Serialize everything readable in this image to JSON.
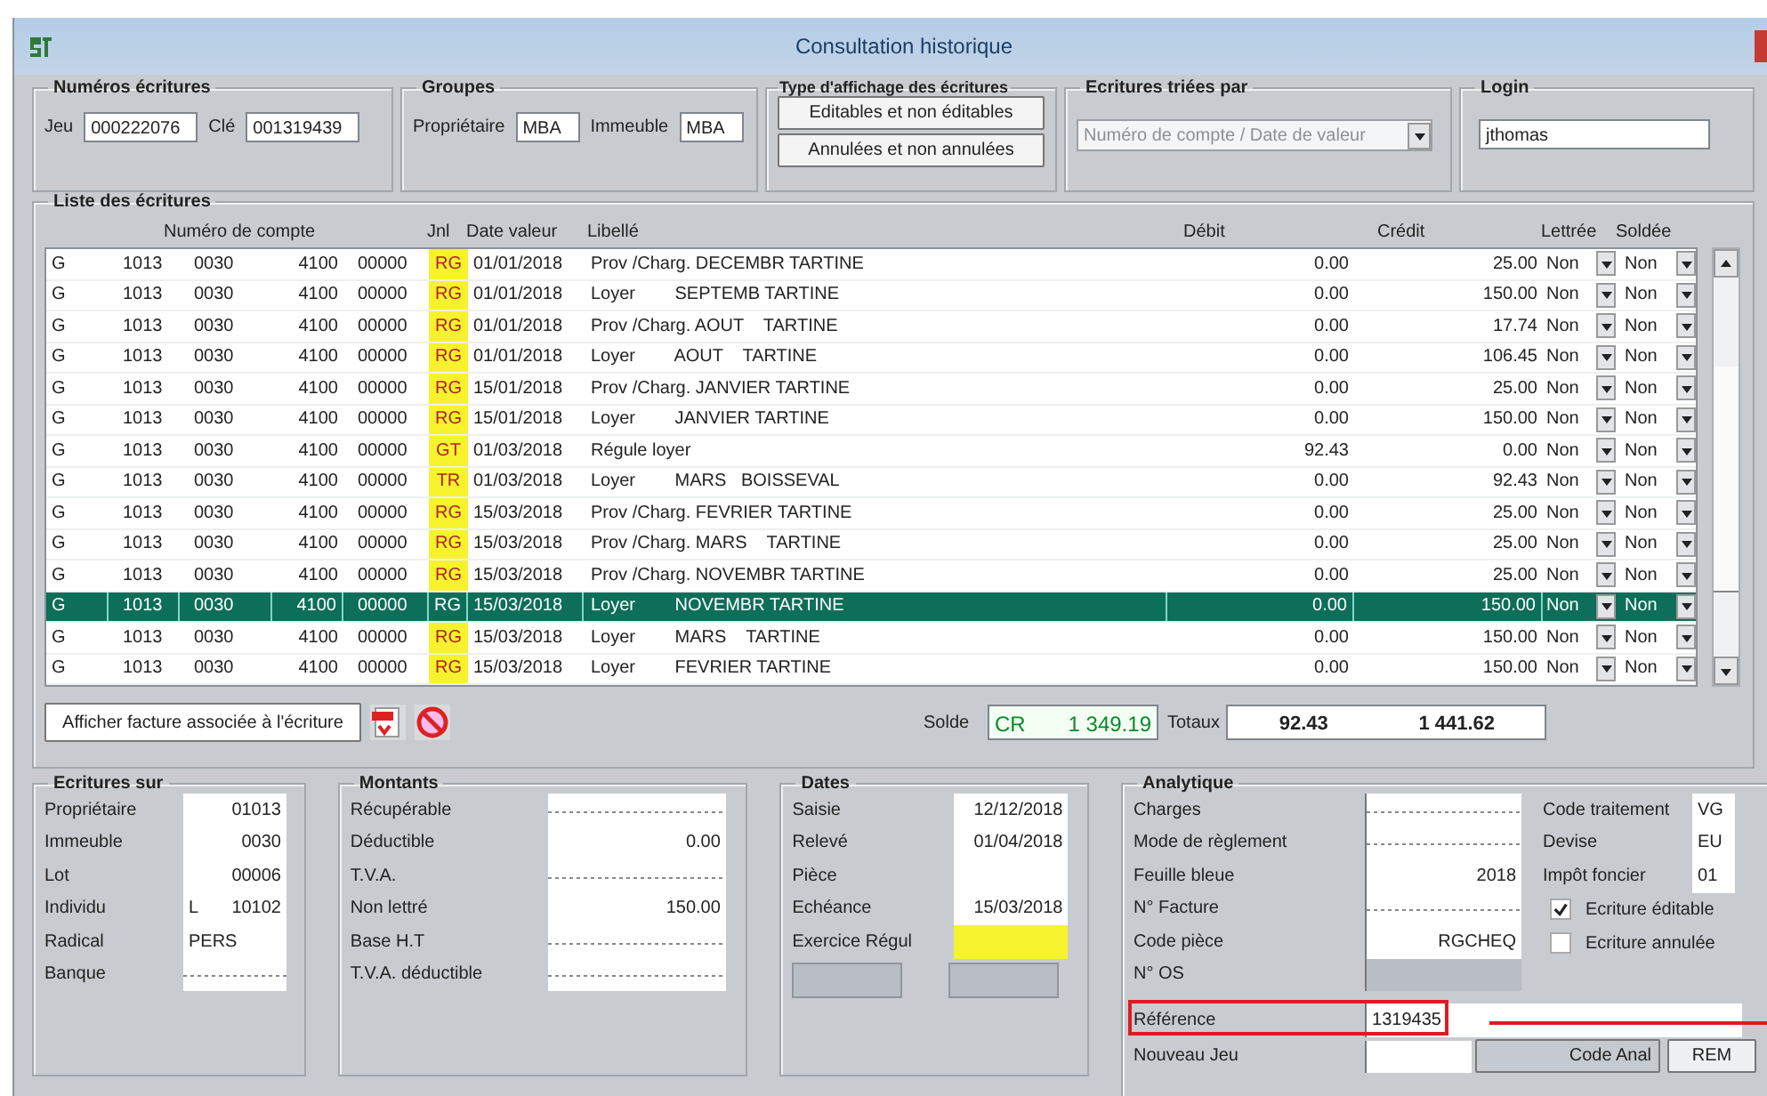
{
  "window": {
    "title": "Consultation historique"
  },
  "numeros": {
    "title": "Numéros écritures",
    "fields": [
      {
        "label": "Jeu",
        "value": "000222076"
      },
      {
        "label": "Clé",
        "value": "001319439"
      }
    ]
  },
  "groupes": {
    "title": "Groupes",
    "fields": [
      {
        "label": "Propriétaire",
        "value": "MBA"
      },
      {
        "label": "Immeuble",
        "value": "MBA"
      }
    ]
  },
  "affichage": {
    "title": "Type d'affichage des écritures",
    "buttons": [
      "Editables et non éditables",
      "Annulées et non annulées"
    ]
  },
  "tri": {
    "title": "Ecritures triées par",
    "value": "Numéro de compte / Date de valeur",
    "disabled": true
  },
  "login": {
    "title": "Login",
    "value": "jthomas"
  },
  "list": {
    "title": "Liste des écritures",
    "columns": [
      "Numéro de compte",
      "Jnl",
      "Date valeur",
      "Libellé",
      "Débit",
      "Crédit",
      "Lettrée",
      "Soldée"
    ],
    "rows": [
      {
        "type": "G",
        "account": [
          "1013",
          "0030",
          "4100",
          "00000"
        ],
        "jnl": "RG",
        "date": "01/01/2018",
        "libelle": "Prov /Charg. DECEMBR TARTINE",
        "debit": "0.00",
        "credit": "25.00",
        "lettree": "Non",
        "soldee": "Non",
        "selected": false
      },
      {
        "type": "G",
        "account": [
          "1013",
          "0030",
          "4100",
          "00000"
        ],
        "jnl": "RG",
        "date": "01/01/2018",
        "libelle": "Loyer        SEPTEMB TARTINE",
        "debit": "0.00",
        "credit": "150.00",
        "lettree": "Non",
        "soldee": "Non",
        "selected": false
      },
      {
        "type": "G",
        "account": [
          "1013",
          "0030",
          "4100",
          "00000"
        ],
        "jnl": "RG",
        "date": "01/01/2018",
        "libelle": "Prov /Charg. AOUT    TARTINE",
        "debit": "0.00",
        "credit": "17.74",
        "lettree": "Non",
        "soldee": "Non",
        "selected": false
      },
      {
        "type": "G",
        "account": [
          "1013",
          "0030",
          "4100",
          "00000"
        ],
        "jnl": "RG",
        "date": "01/01/2018",
        "libelle": "Loyer        AOUT    TARTINE",
        "debit": "0.00",
        "credit": "106.45",
        "lettree": "Non",
        "soldee": "Non",
        "selected": false
      },
      {
        "type": "G",
        "account": [
          "1013",
          "0030",
          "4100",
          "00000"
        ],
        "jnl": "RG",
        "date": "15/01/2018",
        "libelle": "Prov /Charg. JANVIER TARTINE",
        "debit": "0.00",
        "credit": "25.00",
        "lettree": "Non",
        "soldee": "Non",
        "selected": false
      },
      {
        "type": "G",
        "account": [
          "1013",
          "0030",
          "4100",
          "00000"
        ],
        "jnl": "RG",
        "date": "15/01/2018",
        "libelle": "Loyer        JANVIER TARTINE",
        "debit": "0.00",
        "credit": "150.00",
        "lettree": "Non",
        "soldee": "Non",
        "selected": false
      },
      {
        "type": "G",
        "account": [
          "1013",
          "0030",
          "4100",
          "00000"
        ],
        "jnl": "GT",
        "date": "01/03/2018",
        "libelle": "Régule loyer",
        "debit": "92.43",
        "credit": "0.00",
        "lettree": "Non",
        "soldee": "Non",
        "selected": false
      },
      {
        "type": "G",
        "account": [
          "1013",
          "0030",
          "4100",
          "00000"
        ],
        "jnl": "TR",
        "date": "01/03/2018",
        "libelle": "Loyer        MARS   BOISSEVAL",
        "debit": "0.00",
        "credit": "92.43",
        "lettree": "Non",
        "soldee": "Non",
        "selected": false
      },
      {
        "type": "G",
        "account": [
          "1013",
          "0030",
          "4100",
          "00000"
        ],
        "jnl": "RG",
        "date": "15/03/2018",
        "libelle": "Prov /Charg. FEVRIER TARTINE",
        "debit": "0.00",
        "credit": "25.00",
        "lettree": "Non",
        "soldee": "Non",
        "selected": false
      },
      {
        "type": "G",
        "account": [
          "1013",
          "0030",
          "4100",
          "00000"
        ],
        "jnl": "RG",
        "date": "15/03/2018",
        "libelle": "Prov /Charg. MARS    TARTINE",
        "debit": "0.00",
        "credit": "25.00",
        "lettree": "Non",
        "soldee": "Non",
        "selected": false
      },
      {
        "type": "G",
        "account": [
          "1013",
          "0030",
          "4100",
          "00000"
        ],
        "jnl": "RG",
        "date": "15/03/2018",
        "libelle": "Prov /Charg. NOVEMBR TARTINE",
        "debit": "0.00",
        "credit": "25.00",
        "lettree": "Non",
        "soldee": "Non",
        "selected": false
      },
      {
        "type": "G",
        "account": [
          "1013",
          "0030",
          "4100",
          "00000"
        ],
        "jnl": "RG",
        "date": "15/03/2018",
        "libelle": "Loyer        NOVEMBR TARTINE",
        "debit": "0.00",
        "credit": "150.00",
        "lettree": "Non",
        "soldee": "Non",
        "selected": true
      },
      {
        "type": "G",
        "account": [
          "1013",
          "0030",
          "4100",
          "00000"
        ],
        "jnl": "RG",
        "date": "15/03/2018",
        "libelle": "Loyer        MARS    TARTINE",
        "debit": "0.00",
        "credit": "150.00",
        "lettree": "Non",
        "soldee": "Non",
        "selected": false
      },
      {
        "type": "G",
        "account": [
          "1013",
          "0030",
          "4100",
          "00000"
        ],
        "jnl": "RG",
        "date": "15/03/2018",
        "libelle": "Loyer        FEVRIER TARTINE",
        "debit": "0.00",
        "credit": "150.00",
        "lettree": "Non",
        "soldee": "Non",
        "selected": false
      }
    ],
    "invoice_button": "Afficher facture associée à l'écriture",
    "solde": {
      "label": "Solde",
      "sense": "CR",
      "value": "1 349.19"
    },
    "totaux": {
      "label": "Totaux",
      "debit": "92.43",
      "credit": "1 441.62"
    }
  },
  "ecritures_sur": {
    "title": "Ecritures sur",
    "fields": [
      {
        "label": "Propriétaire",
        "value": "01013"
      },
      {
        "label": "Immeuble",
        "value": "0030"
      },
      {
        "label": "Lot",
        "value": "00006"
      },
      {
        "label": "Individu",
        "prefix": "L",
        "value": "10102"
      },
      {
        "label": "Radical",
        "value": "PERS",
        "left_aligned": true
      },
      {
        "label": "Banque",
        "dashed": true
      }
    ]
  },
  "montants": {
    "title": "Montants",
    "fields": [
      {
        "label": "Récupérable",
        "dashed": true
      },
      {
        "label": "Déductible",
        "value": "0.00"
      },
      {
        "label": "T.V.A.",
        "dashed": true
      },
      {
        "label": "Non lettré",
        "value": "150.00"
      },
      {
        "label": "Base H.T",
        "dashed": true
      },
      {
        "label": "T.V.A. déductible",
        "dashed": true
      }
    ]
  },
  "dates": {
    "title": "Dates",
    "fields": [
      {
        "label": "Saisie",
        "value": "12/12/2018"
      },
      {
        "label": "Relevé",
        "value": "01/04/2018"
      },
      {
        "label": "Pièce"
      },
      {
        "label": "Echéance",
        "value": "15/03/2018"
      },
      {
        "label": "Exercice Régul",
        "highlighted": true
      }
    ]
  },
  "analytique": {
    "title": "Analytique",
    "fields": [
      {
        "label": "Charges",
        "dashed": true
      },
      {
        "label": "Mode de règlement",
        "dashed": true
      },
      {
        "label": "Feuille bleue",
        "value": "2018"
      },
      {
        "label": "N° Facture",
        "dashed": true
      },
      {
        "label": "Code pièce",
        "value": "RGCHEQ"
      },
      {
        "label": "N° OS",
        "disabled": true
      }
    ],
    "reference": {
      "label": "Référence",
      "value": "1319435",
      "highlighted": true
    },
    "nouveau_jeu": {
      "label": "Nouveau Jeu"
    },
    "codes": [
      {
        "label": "Code traitement",
        "value": "VG"
      },
      {
        "label": "Devise",
        "value": "EU"
      },
      {
        "label": "Impôt foncier",
        "value": "01"
      }
    ],
    "checks": [
      {
        "label": "Ecriture éditable",
        "checked": true
      },
      {
        "label": "Ecriture annulée",
        "checked": false
      }
    ],
    "buttons": [
      "Code Anal",
      "REM"
    ]
  }
}
